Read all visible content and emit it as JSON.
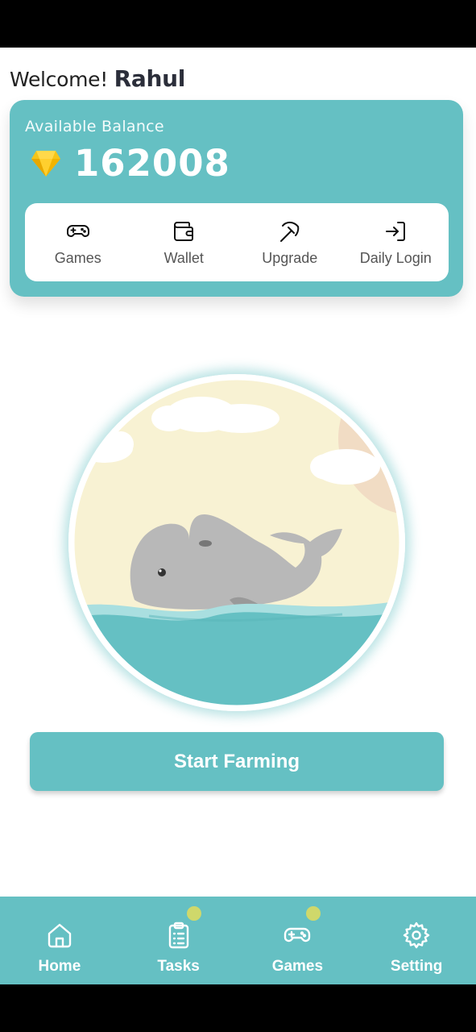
{
  "header": {
    "welcome_prefix": "Welcome!",
    "user_name": "Rahul"
  },
  "balance": {
    "label": "Available Balance",
    "value": "162008",
    "icon": "diamond-icon"
  },
  "quick_actions": [
    {
      "label": "Games",
      "icon": "gamepad-icon"
    },
    {
      "label": "Wallet",
      "icon": "wallet-icon"
    },
    {
      "label": "Upgrade",
      "icon": "pickaxe-icon"
    },
    {
      "label": "Daily Login",
      "icon": "login-icon"
    }
  ],
  "farm": {
    "button_label": "Start Farming",
    "image": "whale-illustration"
  },
  "nav": [
    {
      "label": "Home",
      "icon": "home-icon",
      "badge": false
    },
    {
      "label": "Tasks",
      "icon": "clipboard-icon",
      "badge": true
    },
    {
      "label": "Games",
      "icon": "gamepad-icon",
      "badge": true
    },
    {
      "label": "Setting",
      "icon": "gear-icon",
      "badge": false
    }
  ],
  "colors": {
    "accent": "#65c0c3",
    "badge": "#cfd86b",
    "gem": "#f5c518"
  }
}
